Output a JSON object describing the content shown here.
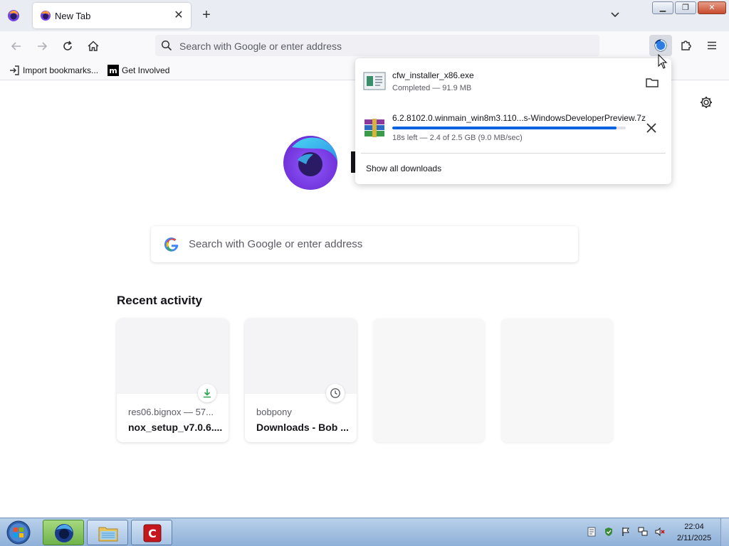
{
  "window": {
    "tab_title": "New Tab",
    "icons": {
      "app_menu": "firefox-icon",
      "tab_favicon": "firefox-icon",
      "tab_close": "close-icon",
      "new_tab": "plus-icon",
      "tab_list": "chevron-down-icon",
      "minimize": "minimize-icon",
      "restore": "restore-icon",
      "close": "close-icon"
    }
  },
  "toolbar": {
    "url_placeholder": "Search with Google or enter address",
    "icons": {
      "back": "arrow-left-icon",
      "forward": "arrow-right-icon",
      "reload": "reload-icon",
      "home": "home-icon",
      "search": "search-icon",
      "downloads": "download-progress-icon",
      "extensions": "puzzle-icon",
      "menu": "hamburger-icon"
    }
  },
  "bookmarks": [
    {
      "label": "Import bookmarks...",
      "icon": "import-icon"
    },
    {
      "label": "Get Involved",
      "icon": "mozilla-icon"
    }
  ],
  "newtab": {
    "search_placeholder": "Search with Google or enter address",
    "recent_title": "Recent activity",
    "cards": [
      {
        "host": "res06.bignox — 57...",
        "title": "nox_setup_v7.0.6....",
        "badge": "download-icon"
      },
      {
        "host": "bobpony",
        "title": "Downloads - Bob ...",
        "badge": "clock-icon"
      }
    ],
    "icons": {
      "settings": "gear-icon",
      "logo": "firefox-logo",
      "google": "google-g-icon"
    }
  },
  "downloads_panel": {
    "items": [
      {
        "filename": "cfw_installer_x86.exe",
        "status": "Completed — 91.9 MB",
        "action_icon": "folder-icon",
        "file_icon": "installer-file-icon"
      },
      {
        "filename": "6.2.8102.0.winmain_win8m3.110...s-WindowsDeveloperPreview.7z",
        "status": "18s left — 2.4 of 2.5 GB (9.0 MB/sec)",
        "action_icon": "close-icon",
        "file_icon": "archive-file-icon",
        "progress": 0.96
      }
    ],
    "show_all": "Show all downloads"
  },
  "taskbar": {
    "clock_time": "22:04",
    "clock_date": "2/11/2025",
    "apps": [
      "start-orb-icon",
      "firefox-icon",
      "explorer-icon",
      "comodo-icon"
    ],
    "tray": [
      "notes-icon",
      "security-icon",
      "flag-icon",
      "network-icon",
      "volume-muted-icon"
    ]
  },
  "colors": {
    "accent": "#0061e0",
    "download_green": "#2ea44f"
  }
}
